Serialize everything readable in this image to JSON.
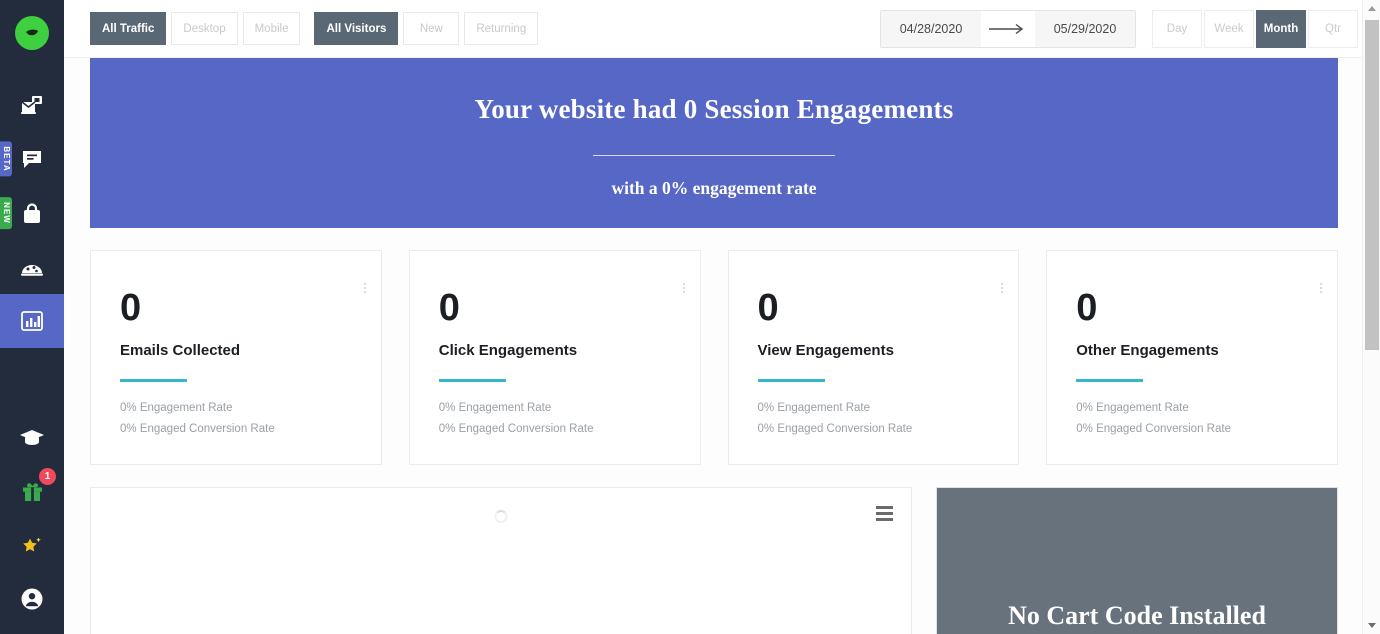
{
  "sidebar": {
    "logo": {
      "icon": "leaf-logo-icon"
    },
    "top_items": [
      {
        "name": "campaigns",
        "icon": "envelope-window-icon",
        "active": false,
        "badge": null,
        "count": null
      },
      {
        "name": "messages",
        "icon": "chat-bubble-icon",
        "active": false,
        "badge": "BETA",
        "count": null
      },
      {
        "name": "shop",
        "icon": "shopping-bag-icon",
        "active": false,
        "badge": "NEW",
        "count": null
      },
      {
        "name": "cookie",
        "icon": "cookie-icon",
        "active": false,
        "badge": null,
        "count": null
      },
      {
        "name": "analytics",
        "icon": "bar-chart-icon",
        "active": true,
        "badge": null,
        "count": null
      }
    ],
    "bottom_items": [
      {
        "name": "academy",
        "icon": "graduation-cap-icon",
        "active": false,
        "badge": null,
        "count": null
      },
      {
        "name": "rewards",
        "icon": "gift-icon",
        "active": false,
        "badge": null,
        "count": "1"
      },
      {
        "name": "favorites",
        "icon": "star-icon",
        "active": false,
        "badge": null,
        "count": null
      },
      {
        "name": "account",
        "icon": "user-circle-icon",
        "active": false,
        "badge": null,
        "count": null
      }
    ]
  },
  "topbar": {
    "traffic_tabs": [
      {
        "label": "All Traffic",
        "active": true
      },
      {
        "label": "Desktop",
        "active": false
      },
      {
        "label": "Mobile",
        "active": false
      }
    ],
    "visitor_tabs": [
      {
        "label": "All Visitors",
        "active": true
      },
      {
        "label": "New",
        "active": false
      },
      {
        "label": "Returning",
        "active": false
      }
    ],
    "date_range": {
      "start": "04/28/2020",
      "end": "05/29/2020",
      "arrow_icon": "arrow-right-icon"
    },
    "period_tabs": [
      {
        "label": "Day",
        "active": false
      },
      {
        "label": "Week",
        "active": false
      },
      {
        "label": "Month",
        "active": true
      },
      {
        "label": "Qtr",
        "active": false
      }
    ]
  },
  "hero": {
    "headline": "Your website had 0 Session Engagements",
    "subline": "with a 0% engagement rate",
    "background_color": "#5767c6"
  },
  "cards": [
    {
      "metric": "0",
      "title": "Emails Collected",
      "engagement_rate": "0% Engagement Rate",
      "conversion_rate": "0% Engaged Conversion Rate",
      "accent_color": "#36b6cc",
      "info_icon": "info-dots-icon"
    },
    {
      "metric": "0",
      "title": "Click Engagements",
      "engagement_rate": "0% Engagement Rate",
      "conversion_rate": "0% Engaged Conversion Rate",
      "accent_color": "#36b6cc",
      "info_icon": "info-dots-icon"
    },
    {
      "metric": "0",
      "title": "View Engagements",
      "engagement_rate": "0% Engagement Rate",
      "conversion_rate": "0% Engaged Conversion Rate",
      "accent_color": "#36b6cc",
      "info_icon": "info-dots-icon"
    },
    {
      "metric": "0",
      "title": "Other Engagements",
      "engagement_rate": "0% Engagement Rate",
      "conversion_rate": "0% Engaged Conversion Rate",
      "accent_color": "#36b6cc",
      "info_icon": "info-dots-icon"
    }
  ],
  "chart_panel": {
    "state": "loading",
    "menu_icon": "hamburger-menu-icon",
    "spinner_icon": "loading-spinner-icon"
  },
  "cart_panel": {
    "title": "No Cart Code Installed",
    "background_color": "#67727d"
  },
  "scrollbar": {
    "up_icon": "scroll-up-arrow-icon",
    "down_icon": "scroll-down-arrow-icon"
  }
}
